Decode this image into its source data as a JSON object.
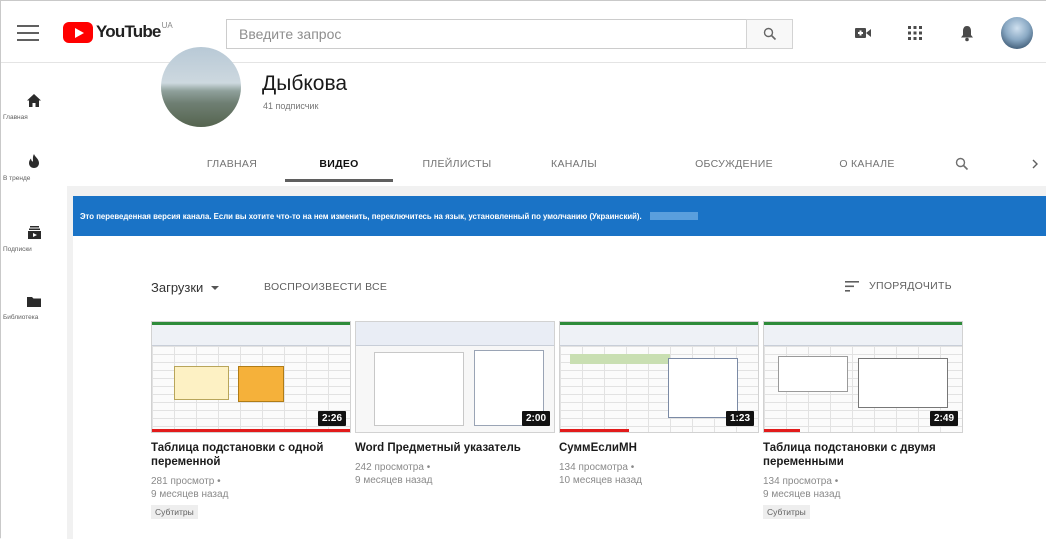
{
  "header": {
    "logo_text": "YouTube",
    "logo_region": "UA",
    "search_placeholder": "Введите запрос",
    "icons": [
      "menu-icon",
      "search-icon",
      "video-camera-icon",
      "apps-grid-icon",
      "bell-icon"
    ]
  },
  "sidebar": {
    "items": [
      {
        "label": "Главная",
        "icon": "home-icon"
      },
      {
        "label": "В тренде",
        "icon": "trending-icon"
      },
      {
        "label": "Подписки",
        "icon": "subscriptions-icon"
      },
      {
        "label": "Библиотека",
        "icon": "library-icon"
      }
    ]
  },
  "channel": {
    "name": "Дыбкова",
    "subscribers": "41 подписчик",
    "tabs": [
      "ГЛАВНАЯ",
      "ВИДЕО",
      "ПЛЕЙЛИСТЫ",
      "КАНАЛЫ",
      "ОБСУЖДЕНИЕ",
      "О КАНАЛЕ"
    ],
    "active_tab": "ВИДЕО"
  },
  "banner": {
    "text": "Это переведенная версия канала. Если вы хотите что-то на нем изменить, переключитесь на язык, установленный по умолчанию (Украинский)."
  },
  "uploads": {
    "label": "Загрузки",
    "play_all": "ВОСПРОИЗВЕСТИ ВСЕ",
    "sort": "УПОРЯДОЧИТЬ"
  },
  "videos": [
    {
      "title": "Таблица подстановки с одной переменной",
      "duration": "2:26",
      "views": "281 просмотр",
      "age": "9 месяцев назад",
      "badge": "Субтитры",
      "progress": 1.0
    },
    {
      "title": "Word Предметный указатель",
      "duration": "2:00",
      "views": "242 просмотра",
      "age": "9 месяцев назад",
      "badge": "",
      "progress": 0
    },
    {
      "title": "СуммЕслиМН",
      "duration": "1:23",
      "views": "134 просмотра",
      "age": "10 месяцев назад",
      "badge": "",
      "progress": 0.35
    },
    {
      "title": "Таблица подстановки с двумя переменными",
      "duration": "2:49",
      "views": "134 просмотра",
      "age": "9 месяцев назад",
      "badge": "Субтитры",
      "progress": 0.18
    }
  ],
  "colors": {
    "banner": "#1a73c6",
    "brand_red": "#ff0000",
    "progress_red": "#e21b1b"
  }
}
